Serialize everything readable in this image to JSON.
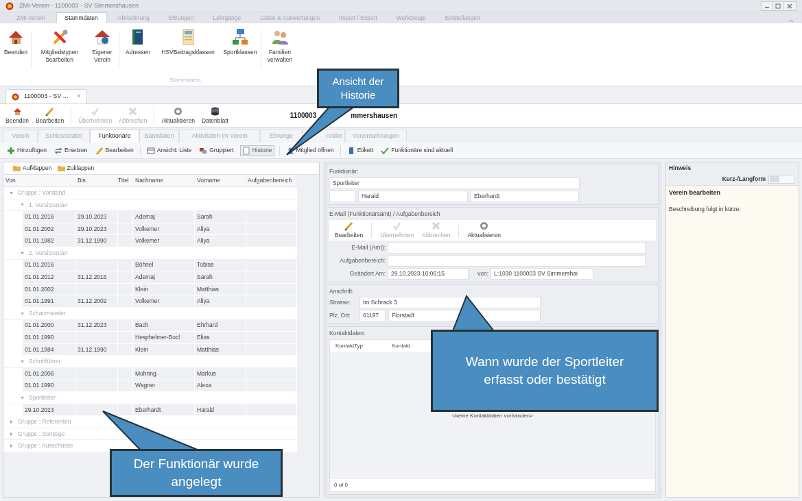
{
  "window": {
    "title": "ZMI-Verein - 1100003 - SV Simmershausen"
  },
  "ribbon": {
    "tabs": [
      {
        "label": "ZMI-Verein",
        "selected": false
      },
      {
        "label": "Stammdaten",
        "selected": true
      },
      {
        "label": "Abrechnung",
        "selected": false
      },
      {
        "label": "Ehrungen",
        "selected": false
      },
      {
        "label": "Lehrgänge",
        "selected": false
      },
      {
        "label": "Listen & Auswertungen",
        "selected": false
      },
      {
        "label": "Import / Export",
        "selected": false
      },
      {
        "label": "Werkzeuge",
        "selected": false
      },
      {
        "label": "Einstellungen",
        "selected": false
      }
    ],
    "buttons": [
      {
        "lines": [
          "Beenden"
        ]
      },
      {
        "lines": [
          "Mitgliedstypen",
          "bearbeiten"
        ]
      },
      {
        "lines": [
          "Eigener",
          "Verein"
        ]
      },
      {
        "lines": [
          "Adressen"
        ]
      },
      {
        "lines": [
          "HSVBeitragsklassen"
        ]
      },
      {
        "lines": [
          "Sportklassen"
        ]
      },
      {
        "lines": [
          "Familien",
          "verwalten"
        ]
      }
    ],
    "group_label": "Stammdaten"
  },
  "document_tab": {
    "label": "1100003 - SV ...",
    "close": "×"
  },
  "toolbar": {
    "buttons": [
      {
        "label": "Beenden",
        "disabled": false
      },
      {
        "label": "Bearbeiten",
        "disabled": false
      },
      {
        "label": "Übernehmen",
        "disabled": true
      },
      {
        "label": "Abbrechen",
        "disabled": true
      },
      {
        "label": "Aktualisieren",
        "disabled": false
      },
      {
        "label": "Datenblatt",
        "disabled": false
      }
    ],
    "title_parts": [
      "1100003",
      "mmershausen"
    ]
  },
  "subtabs": [
    {
      "label": "Verein",
      "selected": false
    },
    {
      "label": "Schiessstätte",
      "selected": false
    },
    {
      "label": "Funktionäre",
      "selected": true
    },
    {
      "label": "Bankdaten",
      "selected": false
    },
    {
      "label": "Aktivitäten im Verein",
      "selected": false
    },
    {
      "label": "Ehrunge",
      "selected": false
    },
    {
      "label": "Ander",
      "selected": false
    },
    {
      "label": "Vereinsehrungen",
      "selected": false
    }
  ],
  "action_bar": [
    {
      "label": "Hinzufügen",
      "pressed": false
    },
    {
      "label": "Ersetzen",
      "pressed": false
    },
    {
      "label": "Bearbeiten",
      "pressed": false
    },
    {
      "label": "Ansicht: Liste",
      "pressed": false
    },
    {
      "label": "Gruppiert",
      "pressed": false
    },
    {
      "label": "Historie",
      "pressed": true
    },
    {
      "label": "Mitglied öffnen",
      "pressed": false
    },
    {
      "label": "Etikett",
      "pressed": false
    },
    {
      "label": "Funktionäre sind aktuell",
      "pressed": false
    }
  ],
  "tree_panel": {
    "buttons": [
      "Aufklappen",
      "Zuklappen"
    ],
    "columns": [
      "Von",
      "Bis",
      "Titel",
      "Nachname",
      "Vorname",
      "Aufgabenbereich"
    ],
    "groups": [
      {
        "label": "Gruppe : Vorstand",
        "expanded": true,
        "children": [
          {
            "label": "1. Vorsitzender",
            "expanded": true,
            "rows": [
              {
                "von": "01.01.2016",
                "bis": "29.10.2023",
                "nachname": "Ademaj",
                "vorname": "Sarah"
              },
              {
                "von": "01.01.2002",
                "bis": "29.10.2023",
                "nachname": "Volkemer",
                "vorname": "Aliya"
              },
              {
                "von": "01.01.1982",
                "bis": "31.12.1990",
                "nachname": "Volkemer",
                "vorname": "Aliya"
              }
            ]
          },
          {
            "label": "2. Vorsitzender",
            "expanded": true,
            "rows": [
              {
                "von": "01.01.2016",
                "nachname": "Böhnel",
                "vorname": "Tobias"
              },
              {
                "von": "01.01.2012",
                "bis": "31.12.2016",
                "nachname": "Ademaj",
                "vorname": "Sarah"
              },
              {
                "von": "01.01.2002",
                "nachname": "Klein",
                "vorname": "Matthias"
              },
              {
                "von": "01.01.1991",
                "bis": "31.12.2002",
                "nachname": "Volkemer",
                "vorname": "Aliya"
              }
            ]
          },
          {
            "label": "Schatzmeister",
            "expanded": true,
            "rows": [
              {
                "von": "01.01.2000",
                "bis": "31.12.2023",
                "nachname": "Bach",
                "vorname": "Ehrhard"
              },
              {
                "von": "01.01.1990",
                "nachname": "Hesphelmer-Bocl",
                "vorname": "Elias"
              },
              {
                "von": "01.01.1984",
                "bis": "31.12.1990",
                "nachname": "Klein",
                "vorname": "Matthias"
              }
            ]
          },
          {
            "label": "Schriftführer",
            "expanded": true,
            "rows": [
              {
                "von": "01.01.2006",
                "nachname": "Mohring",
                "vorname": "Markus"
              },
              {
                "von": "01.01.1990",
                "nachname": "Wagner",
                "vorname": "Alexa"
              }
            ]
          },
          {
            "label": "Sportleiter",
            "expanded": true,
            "rows": [
              {
                "von": "29.10.2023",
                "nachname": "Eberhardt",
                "vorname": "Harald"
              }
            ]
          }
        ]
      },
      {
        "label": "Gruppe : Referenten",
        "expanded": false
      },
      {
        "label": "Gruppe : Sonstige",
        "expanded": false
      },
      {
        "label": "Gruppe : Ausschüsse",
        "expanded": false
      }
    ]
  },
  "detail": {
    "funktionaer": {
      "heading": "Funktionär:",
      "amt": "Sportleiter",
      "vorname": "Harald",
      "nachname": "Eberhardt"
    },
    "email": {
      "heading": "E-Mail (Funktionärsamt) / Aufgabenbereich",
      "buttons": [
        {
          "label": "Bearbeiten",
          "disabled": false
        },
        {
          "label": "Übernehmen",
          "disabled": true
        },
        {
          "label": "Abbrechen",
          "disabled": true
        },
        {
          "label": "Aktualisieren",
          "disabled": false
        }
      ],
      "email_label": "E-Mail (Amt):",
      "aufgaben_label": "Aufgabenbereich:",
      "geaendert_label": "Geändert Am:",
      "geaendert": "29.10.2023 16:06:15",
      "von_label": "von:",
      "von": "L:1030 1100003 SV Simmershai"
    },
    "anschrift": {
      "heading": "Anschrift:",
      "strasse_label": "Strasse:",
      "strasse": "Im Schrack 3",
      "plz_label": "Plz, Ort:",
      "plz": "61197",
      "ort": "Florstadt"
    },
    "kontakt": {
      "heading": "Kontaktdaten:",
      "columns": [
        "KontaktTyp",
        "Kontakt"
      ],
      "empty": "<keine Kontaktdaten vorhanden>",
      "pager": "0 of 0"
    }
  },
  "hint_panel": {
    "title": "Hinweis",
    "toggle_label": "Kurz-/Langform",
    "toggle_on": false,
    "heading": "Verein bearbeiten",
    "text": "Beschreibung folgt in kürze."
  },
  "callouts": [
    {
      "text": "Ansicht der Historie"
    },
    {
      "text": "Wann wurde der Sportleiter erfasst oder bestätigt"
    },
    {
      "text": "Der Funktionär wurde angelegt"
    }
  ]
}
